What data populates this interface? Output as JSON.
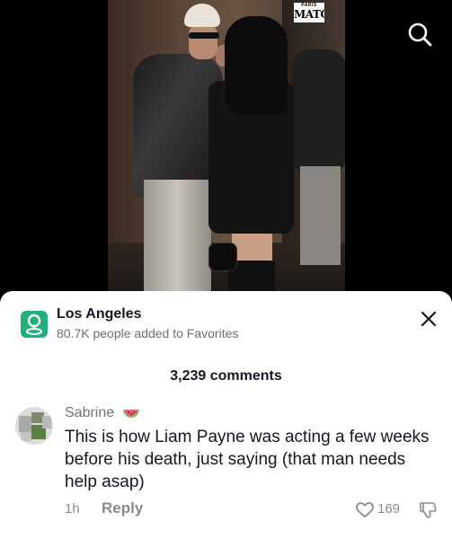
{
  "video": {
    "logo_small": "PARIS",
    "logo_big": "MATCH",
    "search_icon": "search-icon"
  },
  "location": {
    "icon": "location-pin-icon",
    "name": "Los Angeles",
    "subtitle": "80.7K people added to Favorites",
    "close_icon": "close-icon"
  },
  "comments_count": "3,239 comments",
  "comment": {
    "username": "Sabrine",
    "username_emoji": "watermelon-icon",
    "text": "This is how Liam Payne was acting a few weeks before his death, just saying (that man needs help asap)",
    "time": "1h",
    "reply_label": "Reply",
    "likes": "169",
    "like_icon": "heart-icon",
    "dislike_icon": "thumbs-down-icon"
  },
  "colors": {
    "pin_green": "#21b07a",
    "text_primary": "#161823",
    "text_secondary": "#8a8a8e"
  }
}
